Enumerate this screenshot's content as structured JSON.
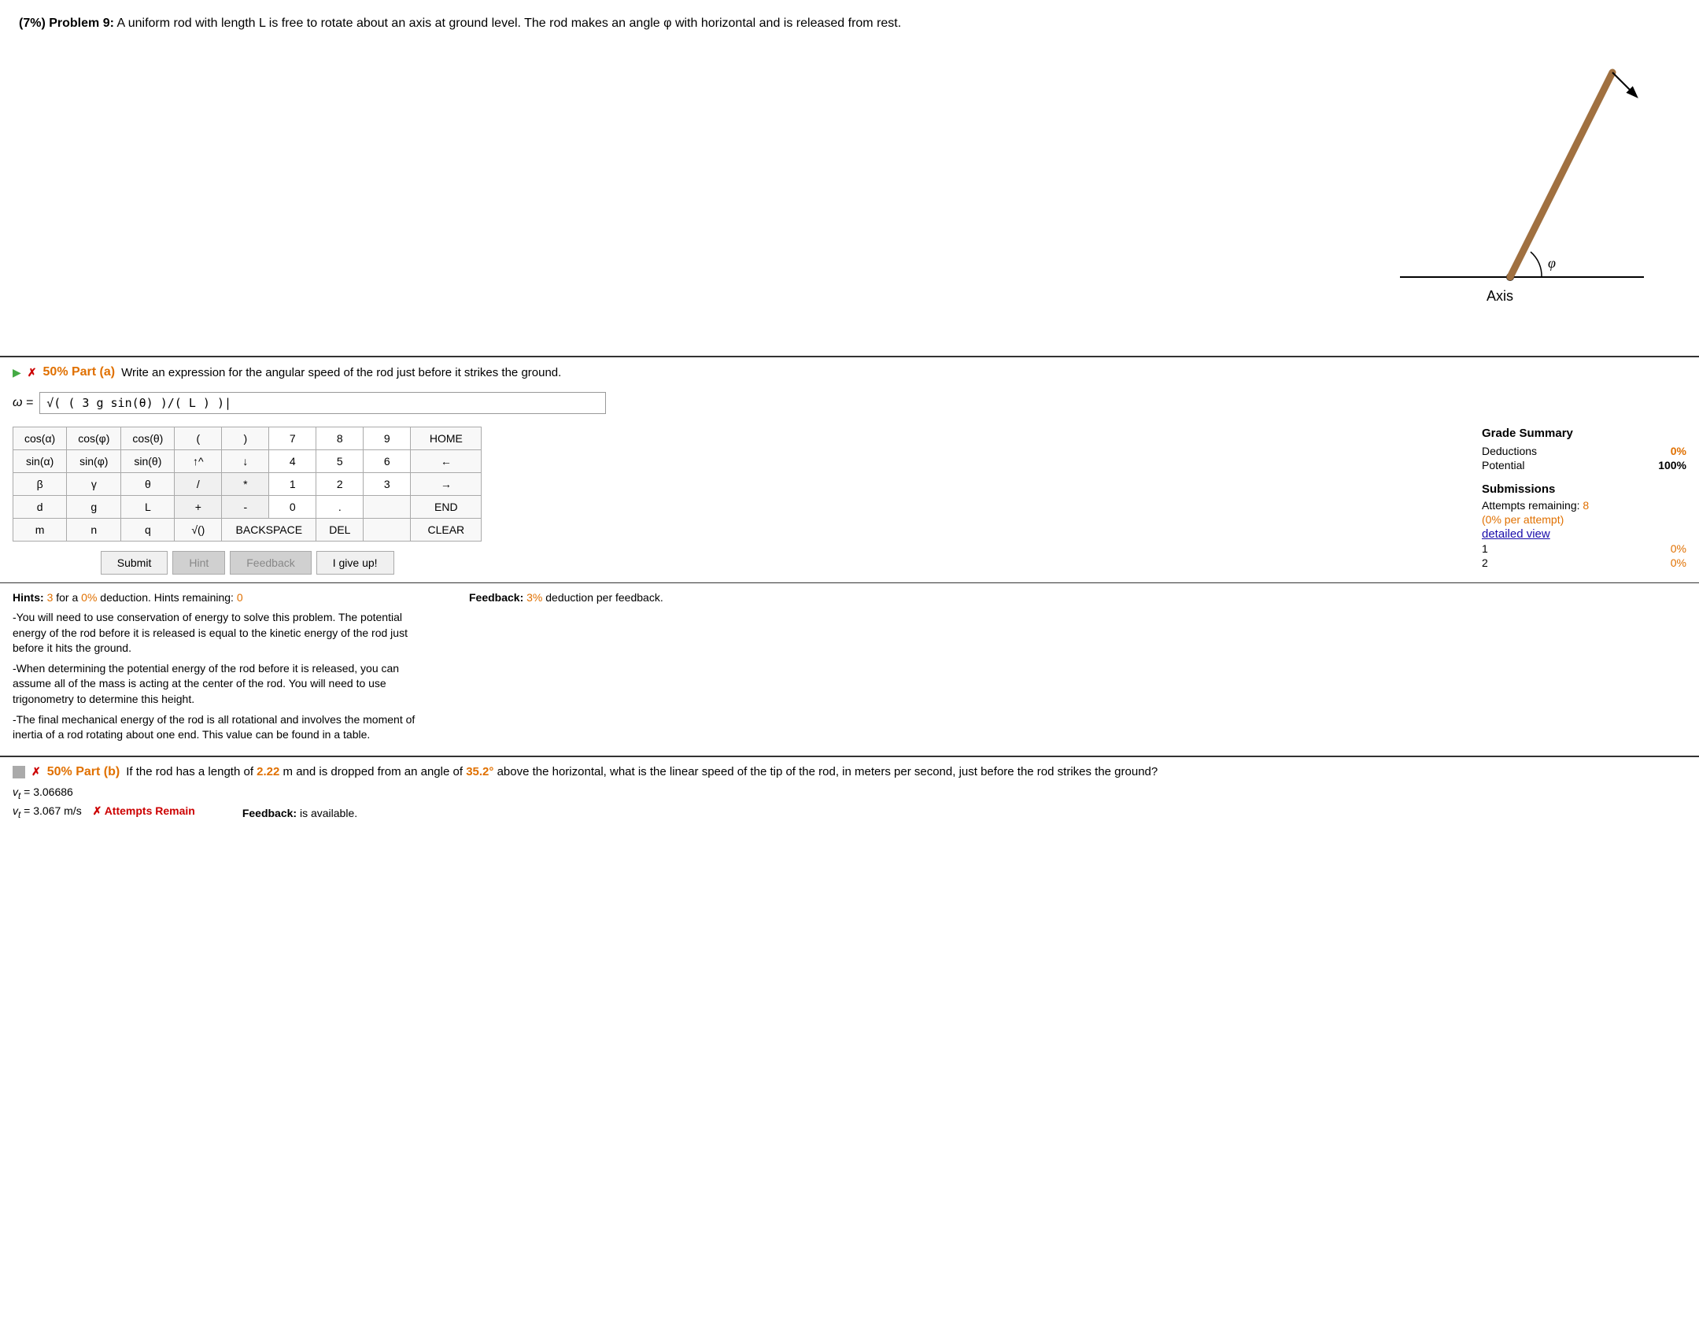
{
  "problem": {
    "number": "Problem 9:",
    "weight": "(7%)",
    "description": "A uniform rod with length L is free to rotate about an axis at ground level. The rod makes an angle φ with horizontal and is released from rest."
  },
  "partA": {
    "label": "50% Part (a)",
    "question": "Write an expression for the angular speed of the rod just before it strikes the ground.",
    "answer_value": "√( ( 3 g sin(θ) )/( L ) )|",
    "omega_symbol": "ω =",
    "calculator": {
      "rows": [
        [
          "cos(α)",
          "cos(φ)",
          "cos(θ)",
          "(",
          ")",
          "7",
          "8",
          "9",
          "HOME"
        ],
        [
          "sin(α)",
          "sin(φ)",
          "sin(θ)",
          "↑^",
          "↓",
          "4",
          "5",
          "6",
          "←"
        ],
        [
          "β",
          "γ",
          "θ",
          "/",
          "*",
          "1",
          "2",
          "3",
          "→"
        ],
        [
          "d",
          "g",
          "L",
          "+",
          "-",
          "0",
          ".",
          "",
          "END"
        ],
        [
          "m",
          "n",
          "q",
          "√()",
          "BACKSPACE",
          "",
          "DEL",
          "",
          "CLEAR"
        ]
      ]
    },
    "buttons": [
      "Submit",
      "Hint",
      "Feedback",
      "I give up!"
    ]
  },
  "gradeSummary": {
    "title": "Grade Summary",
    "deductions_label": "Deductions",
    "deductions_value": "0%",
    "potential_label": "Potential",
    "potential_value": "100%",
    "submissions_title": "Submissions",
    "attempts_label": "Attempts remaining:",
    "attempts_value": "8",
    "per_attempt": "(0% per attempt)",
    "detailed_view": "detailed view",
    "submission_rows": [
      {
        "num": "1",
        "value": "0%"
      },
      {
        "num": "2",
        "value": "0%"
      }
    ]
  },
  "hints": {
    "label": "Hints:",
    "count": "3",
    "deduction_label": "for a",
    "deduction_value": "0%",
    "deduction_text": "deduction. Hints remaining:",
    "remaining": "0",
    "feedback_label": "Feedback:",
    "feedback_deduction": "3%",
    "feedback_text": "deduction per feedback.",
    "hint_texts": [
      "You will need to use conservation of energy to solve this problem. The potential energy of the rod before it is released is equal to the kinetic energy of the rod just before it hits the ground.",
      "When determining the potential energy of the rod before it is released, you can assume all of the mass is acting at the center of the rod. You will need to use trigonometry to determine this height.",
      "The final mechanical energy of the rod is all rotational and involves the moment of inertia of a rod rotating about one end. This value can be found in a table."
    ]
  },
  "partB": {
    "label": "50% Part (b)",
    "question_intro": "If the rod has a length of",
    "length_value": "2.22",
    "length_unit": "m and is dropped from an angle of",
    "angle_value": "35.2°",
    "question_end": "above the horizontal, what is the linear speed of the tip of the rod, in meters per second, just before the rod strikes the ground?",
    "answer1_label": "v_t =",
    "answer1_value": "3.06686",
    "answer2_label": "v_t =",
    "answer2_value": "3.067 m/s",
    "feedback_label": "Feedback:",
    "feedback_value": "is available.",
    "attempts_remain": "✗ Attempts Remain"
  }
}
